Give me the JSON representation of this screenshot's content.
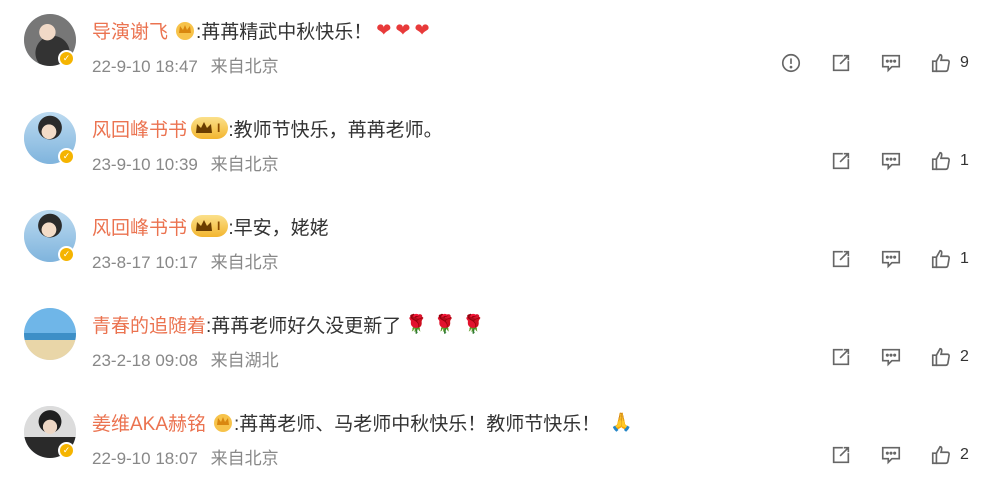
{
  "colors": {
    "username": "#eb7350",
    "meta": "#888888",
    "icon": "#666666",
    "heart": "#e83a3a"
  },
  "comments": [
    {
      "user": "导演谢飞",
      "text": ":苒苒精武中秋快乐！",
      "emoji": "❤❤❤",
      "time": "22-9-10 18:47",
      "location": "来自北京",
      "likes": "9",
      "badge": "crown"
    },
    {
      "user": "风回峰书书",
      "text": ":教师节快乐，苒苒老师。",
      "emoji": "",
      "time": "23-9-10 10:39",
      "location": "来自北京",
      "likes": "1",
      "badge": "level",
      "level": "I"
    },
    {
      "user": "风回峰书书",
      "text": ":早安，姥姥",
      "emoji": "",
      "time": "23-8-17 10:17",
      "location": "来自北京",
      "likes": "1",
      "badge": "level",
      "level": "I"
    },
    {
      "user": "青春的追随着",
      "text": ":苒苒老师好久没更新了",
      "emoji": "🌹🌹🌹",
      "time": "23-2-18 09:08",
      "location": "来自湖北",
      "likes": "2",
      "badge": "none"
    },
    {
      "user": "姜维AKA赫铭",
      "text": ":苒苒老师、马老师中秋快乐！教师节快乐！",
      "emoji": "🙏",
      "time": "22-9-10 18:07",
      "location": "来自北京",
      "likes": "2",
      "badge": "crown"
    }
  ],
  "icons": {
    "report": "exclamation-circle-icon",
    "repost": "repost-icon",
    "reply": "comment-icon",
    "like": "thumbs-up-icon",
    "verified": "verified-badge-icon",
    "crown": "crown-icon"
  }
}
